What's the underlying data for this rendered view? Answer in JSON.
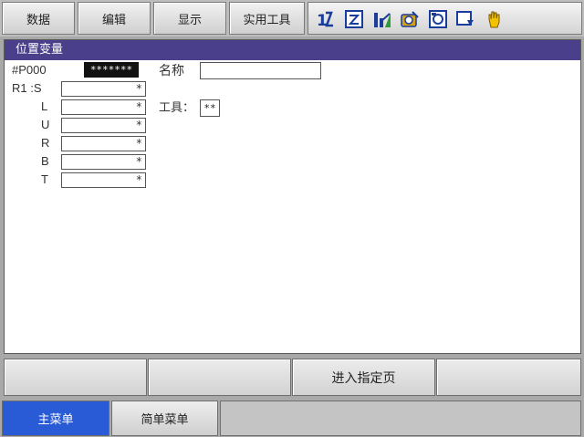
{
  "top_menu": {
    "items": [
      "数据",
      "编辑",
      "显示",
      "实用工具"
    ]
  },
  "toolbar": {
    "icons": [
      "robot-group-icon",
      "edit-page-icon",
      "signal-icon",
      "job-icon",
      "monitor-icon",
      "screen-icon",
      "hand-icon"
    ],
    "accent": "#d4a017"
  },
  "window": {
    "title": "位置变量",
    "variable_label": "#P000",
    "variable_value": "*******",
    "name_label": "名称",
    "name_value": "",
    "robot_label": "R1 :S",
    "axes": [
      {
        "label": "S",
        "value": "*"
      },
      {
        "label": "L",
        "value": "*"
      },
      {
        "label": "U",
        "value": "*"
      },
      {
        "label": "R",
        "value": "*"
      },
      {
        "label": "B",
        "value": "*"
      },
      {
        "label": "T",
        "value": "*"
      }
    ],
    "tool_label": "工具：",
    "tool_value": "**"
  },
  "function_keys": [
    "",
    "",
    "进入指定页",
    ""
  ],
  "bottom_tabs": {
    "main": "主菜单",
    "simple": "简单菜单"
  },
  "colors": {
    "title_bar": "#4a3f8a",
    "active_tab": "#2a5bd7"
  }
}
